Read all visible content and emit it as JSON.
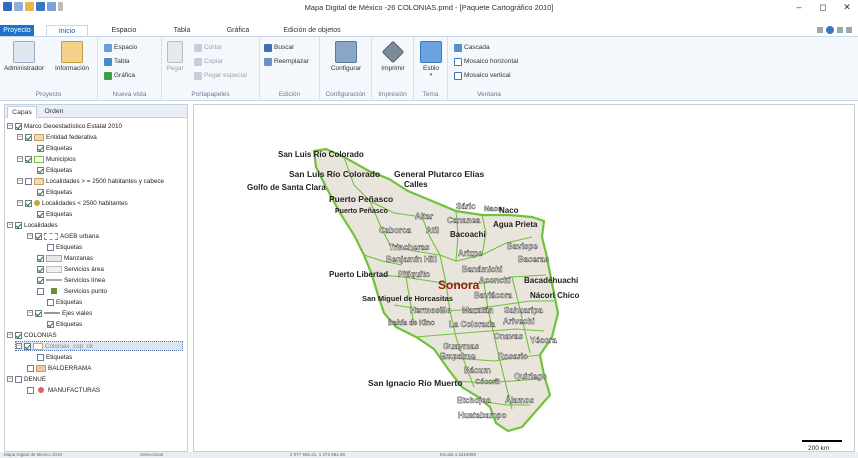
{
  "window": {
    "title": "Mapa Digital de México -26 COLONIAS.pmd - [Paquete Cartográfico 2010]",
    "minimize_glyph": "–",
    "maximize_glyph": "◻",
    "close_glyph": "✕"
  },
  "tabs": {
    "proyecto": "Proyecto",
    "inicio": "Inicio",
    "espacio": "Espacio",
    "tabla": "Tabla",
    "grafica": "Gráfica",
    "edicion": "Edición de objetos"
  },
  "ribbon": {
    "proyecto": {
      "label": "Proyecto",
      "administrador": "Administrador",
      "informacion": "Información"
    },
    "nueva_vista": {
      "label": "Nueva vista",
      "espacio": "Espacio",
      "tabla": "Tabla",
      "grafica": "Gráfica"
    },
    "portapapeles": {
      "label": "Portapapeles",
      "pegar": "Pegar",
      "cortar": "Cortar",
      "copiar": "Copiar",
      "pegar_especial": "Pegar especial"
    },
    "edicion": {
      "label": "Edición",
      "buscar": "Buscar",
      "reemplazar": "Reemplazar"
    },
    "configuracion": {
      "label": "Configuración",
      "configurar": "Configurar"
    },
    "impresion": {
      "label": "Impresión",
      "imprimir": "Imprimir"
    },
    "tema": {
      "label": "Tema",
      "estilo": "Estilo"
    },
    "ventana": {
      "label": "Ventana",
      "cascada": "Cascada",
      "mosaico_horizontal": "Mosaico horizontal",
      "mosaico_vertical": "Mosaico vertical"
    }
  },
  "panel": {
    "tab_capas": "Capas",
    "tab_orden": "Orden",
    "tree": [
      "Marco Geoestadístico Estatal 2010",
      "Entidad federativa",
      "Etiquetas",
      "Municipios",
      "Etiquetas",
      "Localidades > = 2500 habitantes y cabece",
      "Etiquetas",
      "Localidades < 2500 habitantes",
      "Etiquetas",
      "Localidades",
      "AGEB urbana",
      "Etiquetas",
      "Manzanas",
      "Servicios área",
      "Servicios línea",
      "Servicios punto",
      "Etiquetas",
      "Ejes viales",
      "Etiquetas",
      "COLONIAS",
      "Colonias_cop_ok",
      "Etiquetas",
      "BALDERRAMA",
      "DENUE",
      "MANUFACTURAS"
    ]
  },
  "map": {
    "labels": [
      "San Luis Río Colorado",
      "San Luis Río Colorado",
      "General Plutarco Elías",
      "Calles",
      "Golfo de Santa Clara",
      "Puerto Peñasco",
      "Puerto Peñasco",
      "Sáric",
      "Naco",
      "Naco",
      "Altar",
      "Cananea",
      "Agua Prieta",
      "Caborca",
      "Atil",
      "Bacoachi",
      "Trincheras",
      "Arizpe",
      "Bavispe",
      "Benjamín Hill",
      "Bacerac",
      "Banámichi",
      "Puerto Libertad",
      "Pitiquito",
      "Aconchi",
      "Bacadéhuachi",
      "Sonora",
      "San Miguel de Horcasitas",
      "Baviácora",
      "Nácori Chico",
      "Hermosillo",
      "Mazatán",
      "Sahuaripa",
      "Bahía de Kino",
      "La Colorada",
      "Arivechi",
      "Onavas",
      "Yécora",
      "Guaymas",
      "Empalme",
      "Rosario",
      "Bácum",
      "Quiriego",
      "San Ignacio Río Muerto",
      "Cócorit",
      "Etchojoa",
      "Álamos",
      "Huatabampo"
    ],
    "scale_label": "200 km"
  },
  "status": {
    "left": "Mapa Digital de México 2010",
    "mid": "Seleccionar",
    "coords": "2 077 556.21, 1 373 591.88",
    "scale": "Escala 1:3416069"
  },
  "colors": {
    "accent": "#1e73c8",
    "border_green": "#6fc23a",
    "state_fill": "#e9e4dc",
    "desktop_blue": "#1a4f8c"
  }
}
